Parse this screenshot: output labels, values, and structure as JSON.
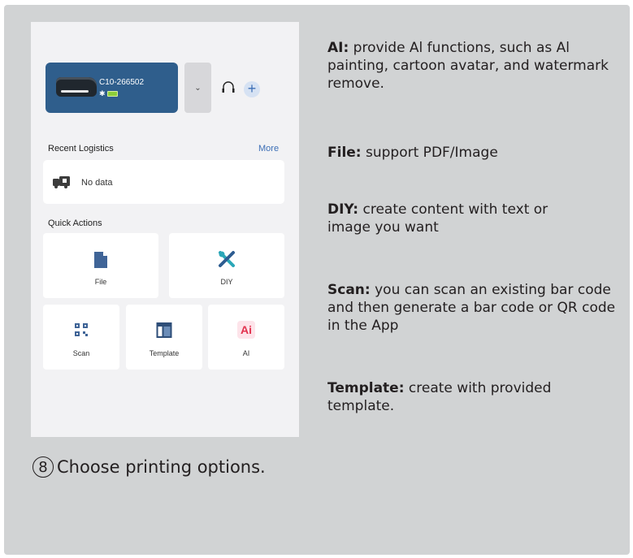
{
  "device": {
    "model": "C10-266502",
    "bluetooth_icon": "bluetooth-icon",
    "battery_icon": "battery-icon"
  },
  "dropdown_icon": "chevron-down",
  "recent": {
    "title": "Recent Logistics",
    "more": "More",
    "empty": "No data"
  },
  "quick_actions": {
    "title": "Quick Actions",
    "file": "File",
    "diy": "DIY",
    "scan": "Scan",
    "template": "Template",
    "ai": "AI",
    "ai_badge": "Ai"
  },
  "descriptions": {
    "ai": {
      "term": "AI:",
      "text": " provide Al functions, such as Al painting, cartoon avatar, and watermark remove."
    },
    "file": {
      "term": "File:",
      "text": " support PDF/Image"
    },
    "diy": {
      "term": "DIY:",
      "text": "  create content with text or image you want"
    },
    "scan": {
      "term": "Scan:",
      "text": " you can scan an existing bar code and then generate a bar code or QR code in the App"
    },
    "template": {
      "term": "Template:",
      "text": " create with provided template."
    }
  },
  "step": {
    "number": "8",
    "text": "Choose printing options."
  },
  "colors": {
    "panel": "#d1d3d4",
    "device_card": "#2f5e8c",
    "accent_blue": "#3d6fb6",
    "ai_red": "#e2334f"
  }
}
